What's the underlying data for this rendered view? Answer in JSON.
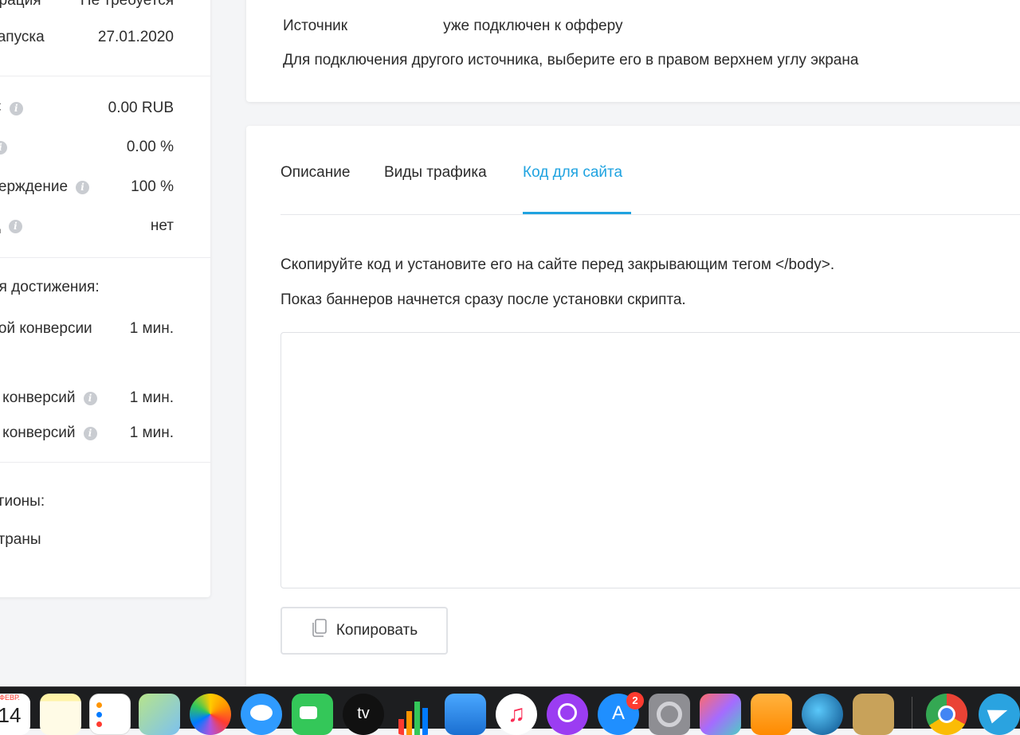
{
  "left_panel": {
    "rows": [
      {
        "label": "ерация",
        "value": "Не требуется"
      },
      {
        "label": "запуска",
        "value": "27.01.2020"
      },
      {
        "label": "C",
        "value": "0.00 RUB"
      },
      {
        "label": "",
        "value": "0.00 %"
      },
      {
        "label": "верждение",
        "value": "100 %"
      },
      {
        "label": "Д",
        "value": "нет"
      },
      {
        "label": "ия достижения:",
        "value": ""
      },
      {
        "label": "вой конверсии",
        "value": "1 мин."
      },
      {
        "label": "ь конверсий",
        "value": "1 мин."
      },
      {
        "label": "ь конверсий",
        "value": "1 мин."
      },
      {
        "label": "егионы:",
        "value": ""
      },
      {
        "label": "страны",
        "value": ""
      }
    ]
  },
  "top_card": {
    "line1_start": "Источник",
    "line1_end": "уже подключен к офферу",
    "line2": "Для подключения другого источника, выберите его в правом верхнем углу экрана"
  },
  "tabs": [
    {
      "label": "Описание",
      "active": false
    },
    {
      "label": "Виды трафика",
      "active": false
    },
    {
      "label": "Код для сайта",
      "active": true
    }
  ],
  "code_section": {
    "instruction1": "Скопируйте код и установите его на сайте перед закрывающим тегом </body>.",
    "instruction2": "Показ баннеров начнется сразу после установки скрипта.",
    "code_value": "",
    "copy_button": "Копировать"
  },
  "dock": {
    "calendar_month": "ФЕВР.",
    "calendar_day": "14",
    "appstore_badge": "2",
    "apps": [
      "calendar-icon",
      "notes-icon",
      "reminders-icon",
      "maps-icon",
      "photos-icon",
      "messages-icon",
      "facetime-icon",
      "apple-tv-icon",
      "numbers-icon",
      "keynote-icon",
      "music-icon",
      "podcasts-icon",
      "app-store-icon",
      "system-preferences-icon",
      "pixelmator-icon",
      "pages-icon",
      "earth-icon",
      "archive-utility-icon",
      "chrome-icon",
      "telegram-icon"
    ]
  },
  "colors": {
    "accent": "#1fa3e0",
    "background": "#f4f5f7",
    "card": "#ffffff"
  }
}
